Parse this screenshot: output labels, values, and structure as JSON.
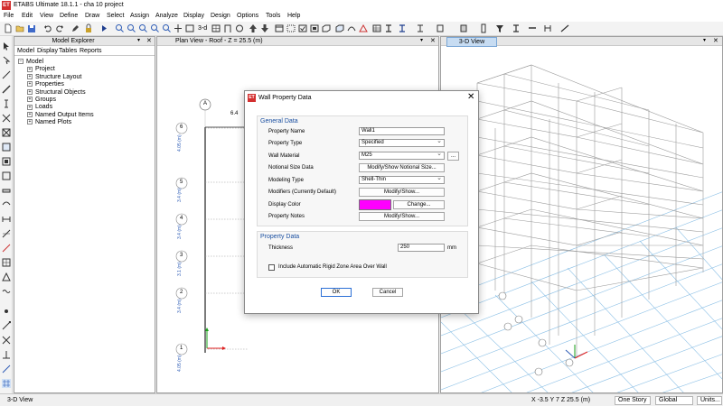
{
  "titlebar": {
    "logo": "ET",
    "title": "ETABS Ultimate 18.1.1 - cha 10 project"
  },
  "menu": [
    "File",
    "Edit",
    "View",
    "Define",
    "Draw",
    "Select",
    "Assign",
    "Analyze",
    "Display",
    "Design",
    "Options",
    "Tools",
    "Help"
  ],
  "toolbar": {
    "view_3d_label": "3-d"
  },
  "explorer": {
    "title": "Model Explorer",
    "tabs": [
      "Model",
      "Display",
      "Tables",
      "Reports"
    ],
    "root": "Model",
    "items": [
      "Project",
      "Structure Layout",
      "Properties",
      "Structural Objects",
      "Groups",
      "Loads",
      "Named Output Items",
      "Named Plots"
    ]
  },
  "plan": {
    "title": "Plan View - Roof - Z = 25.5 (m)",
    "grid_x_bubble": "A",
    "top_dim": "6.4",
    "story_bubbles": [
      "6",
      "5",
      "4",
      "3",
      "2",
      "1"
    ],
    "story_heights": [
      "4.05 (m)",
      "3.4 (m)",
      "3.4 (m)",
      "3.1 (m)",
      "3.4 (m)",
      "4.05 (m)"
    ]
  },
  "view3d": {
    "title": "3-D View"
  },
  "dialog": {
    "logo": "ET",
    "title": "Wall Property Data",
    "close": "✕",
    "general": {
      "heading": "General Data",
      "property_name_label": "Property Name",
      "property_name_value": "Wall1",
      "property_type_label": "Property Type",
      "property_type_value": "Specified",
      "wall_material_label": "Wall Material",
      "wall_material_value": "M25",
      "wall_material_btn": "...",
      "notional_label": "Notional Size Data",
      "notional_btn": "Modify/Show Notional Size...",
      "modeling_label": "Modeling Type",
      "modeling_value": "Shell-Thin",
      "modifiers_label": "Modifiers (Currently Default)",
      "modifiers_btn": "Modify/Show...",
      "color_label": "Display Color",
      "color_hex": "#ff00ff",
      "color_btn": "Change...",
      "notes_label": "Property Notes",
      "notes_btn": "Modify/Show..."
    },
    "property": {
      "heading": "Property Data",
      "thickness_label": "Thickness",
      "thickness_value": "250",
      "thickness_unit": "mm",
      "rigid_zone_label": "Include Automatic Rigid Zone Area Over Wall"
    },
    "ok": "OK",
    "cancel": "Cancel"
  },
  "statusbar": {
    "left": "3-D View",
    "coords": "X -3.5  Y 7  Z 25.5 (m)",
    "story": "One Story",
    "coord_system": "Global",
    "units": "Units..."
  }
}
